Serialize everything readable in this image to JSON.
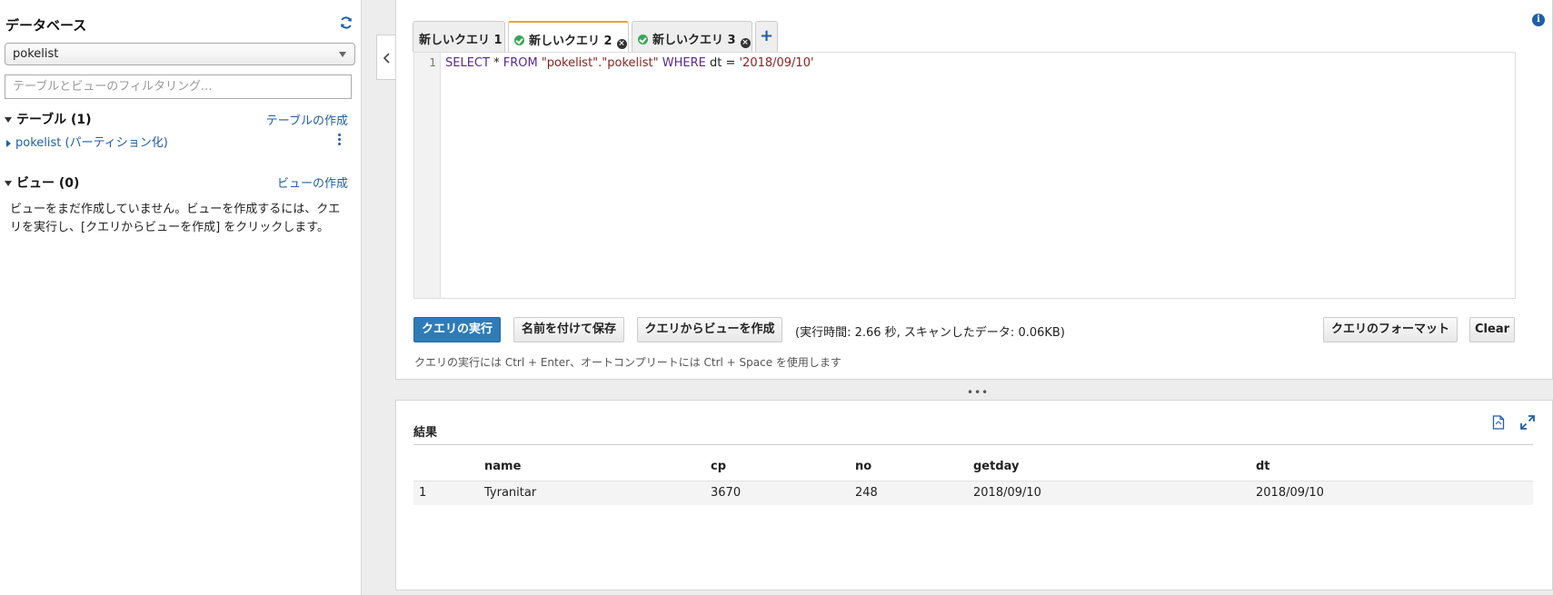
{
  "sidebar": {
    "title": "データベース",
    "database_selected": "pokelist",
    "filter_placeholder": "テーブルとビューのフィルタリング...",
    "tables_header": "テーブル (1)",
    "create_table_link": "テーブルの作成",
    "tables": [
      {
        "label": "pokelist (パーティション化)"
      }
    ],
    "views_header": "ビュー (0)",
    "create_view_link": "ビューの作成",
    "views_note": "ビューをまだ作成していません。ビューを作成するには、クエリを実行し、[クエリからビューを作成] をクリックします。"
  },
  "tabs": [
    {
      "label": "新しいクエリ 1",
      "status": "none",
      "active": false
    },
    {
      "label": "新しいクエリ 2",
      "status": "success",
      "active": true
    },
    {
      "label": "新しいクエリ 3",
      "status": "success",
      "active": false
    }
  ],
  "tab_add_label": "+",
  "editor": {
    "line_number": "1",
    "code_parts": {
      "select": "SELECT",
      "star": " * ",
      "from": "FROM",
      "table": " \"pokelist\".\"pokelist\" ",
      "where": "WHERE",
      "cond": " dt = ",
      "value": "'2018/09/10'"
    }
  },
  "actions": {
    "run": "クエリの実行",
    "save_as": "名前を付けて保存",
    "create_view": "クエリからビューを作成",
    "exec_info": "(実行時間: 2.66 秒, スキャンしたデータ: 0.06KB)",
    "format": "クエリのフォーマット",
    "clear": "Clear",
    "hint": "クエリの実行には Ctrl + Enter、オートコンプリートには Ctrl + Space を使用します"
  },
  "resize_handle": "•••",
  "results": {
    "title": "結果",
    "columns": [
      "name",
      "cp",
      "no",
      "getday",
      "dt"
    ],
    "rows": [
      {
        "index": "1",
        "name": "Tyranitar",
        "cp": "3670",
        "no": "248",
        "getday": "2018/09/10",
        "dt": "2018/09/10"
      }
    ]
  },
  "colors": {
    "primary": "#2e7bb7",
    "link": "#1f5ea8",
    "active_tab_accent": "#f0a030",
    "success": "#3aa655"
  }
}
